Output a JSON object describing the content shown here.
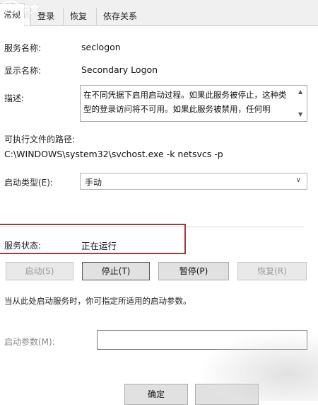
{
  "logo": {
    "php": "php",
    "site": "中文网"
  },
  "tabs": [
    {
      "label": "常规",
      "active": true
    },
    {
      "label": "登录",
      "active": false
    },
    {
      "label": "恢复",
      "active": false
    },
    {
      "label": "依存关系",
      "active": false
    }
  ],
  "fields": {
    "service_name_label": "服务名称:",
    "service_name_value": "seclogon",
    "display_name_label": "显示名称:",
    "display_name_value": "Secondary Logon",
    "description_label": "描述:",
    "description_value": "在不同凭据下启用启动过程。如果此服务被停止，这种类型的登录访问将不可用。如果此服务被禁用，任何明",
    "exe_path_label": "可执行文件的路径:",
    "exe_path_value": "C:\\WINDOWS\\system32\\svchost.exe -k netsvcs -p",
    "startup_type_label": "启动类型(E):",
    "startup_type_value": "手动"
  },
  "status": {
    "label": "服务状态:",
    "value": "正在运行"
  },
  "buttons": {
    "start": "启动(S)",
    "stop": "停止(T)",
    "pause": "暂停(P)",
    "resume": "恢复(R)"
  },
  "hint": "当从此处启动服务时，你可指定所适用的启动参数。",
  "start_params_label": "启动参数(M):",
  "start_params_value": "",
  "ok_button": "确定",
  "colors": {
    "highlight": "#a13a3a",
    "tab_bg": "#f0f0f0"
  },
  "icons": {
    "scroll_up": "scroll-up-arrow-icon",
    "scroll_down": "scroll-down-arrow-icon",
    "dropdown": "chevron-down-icon"
  }
}
